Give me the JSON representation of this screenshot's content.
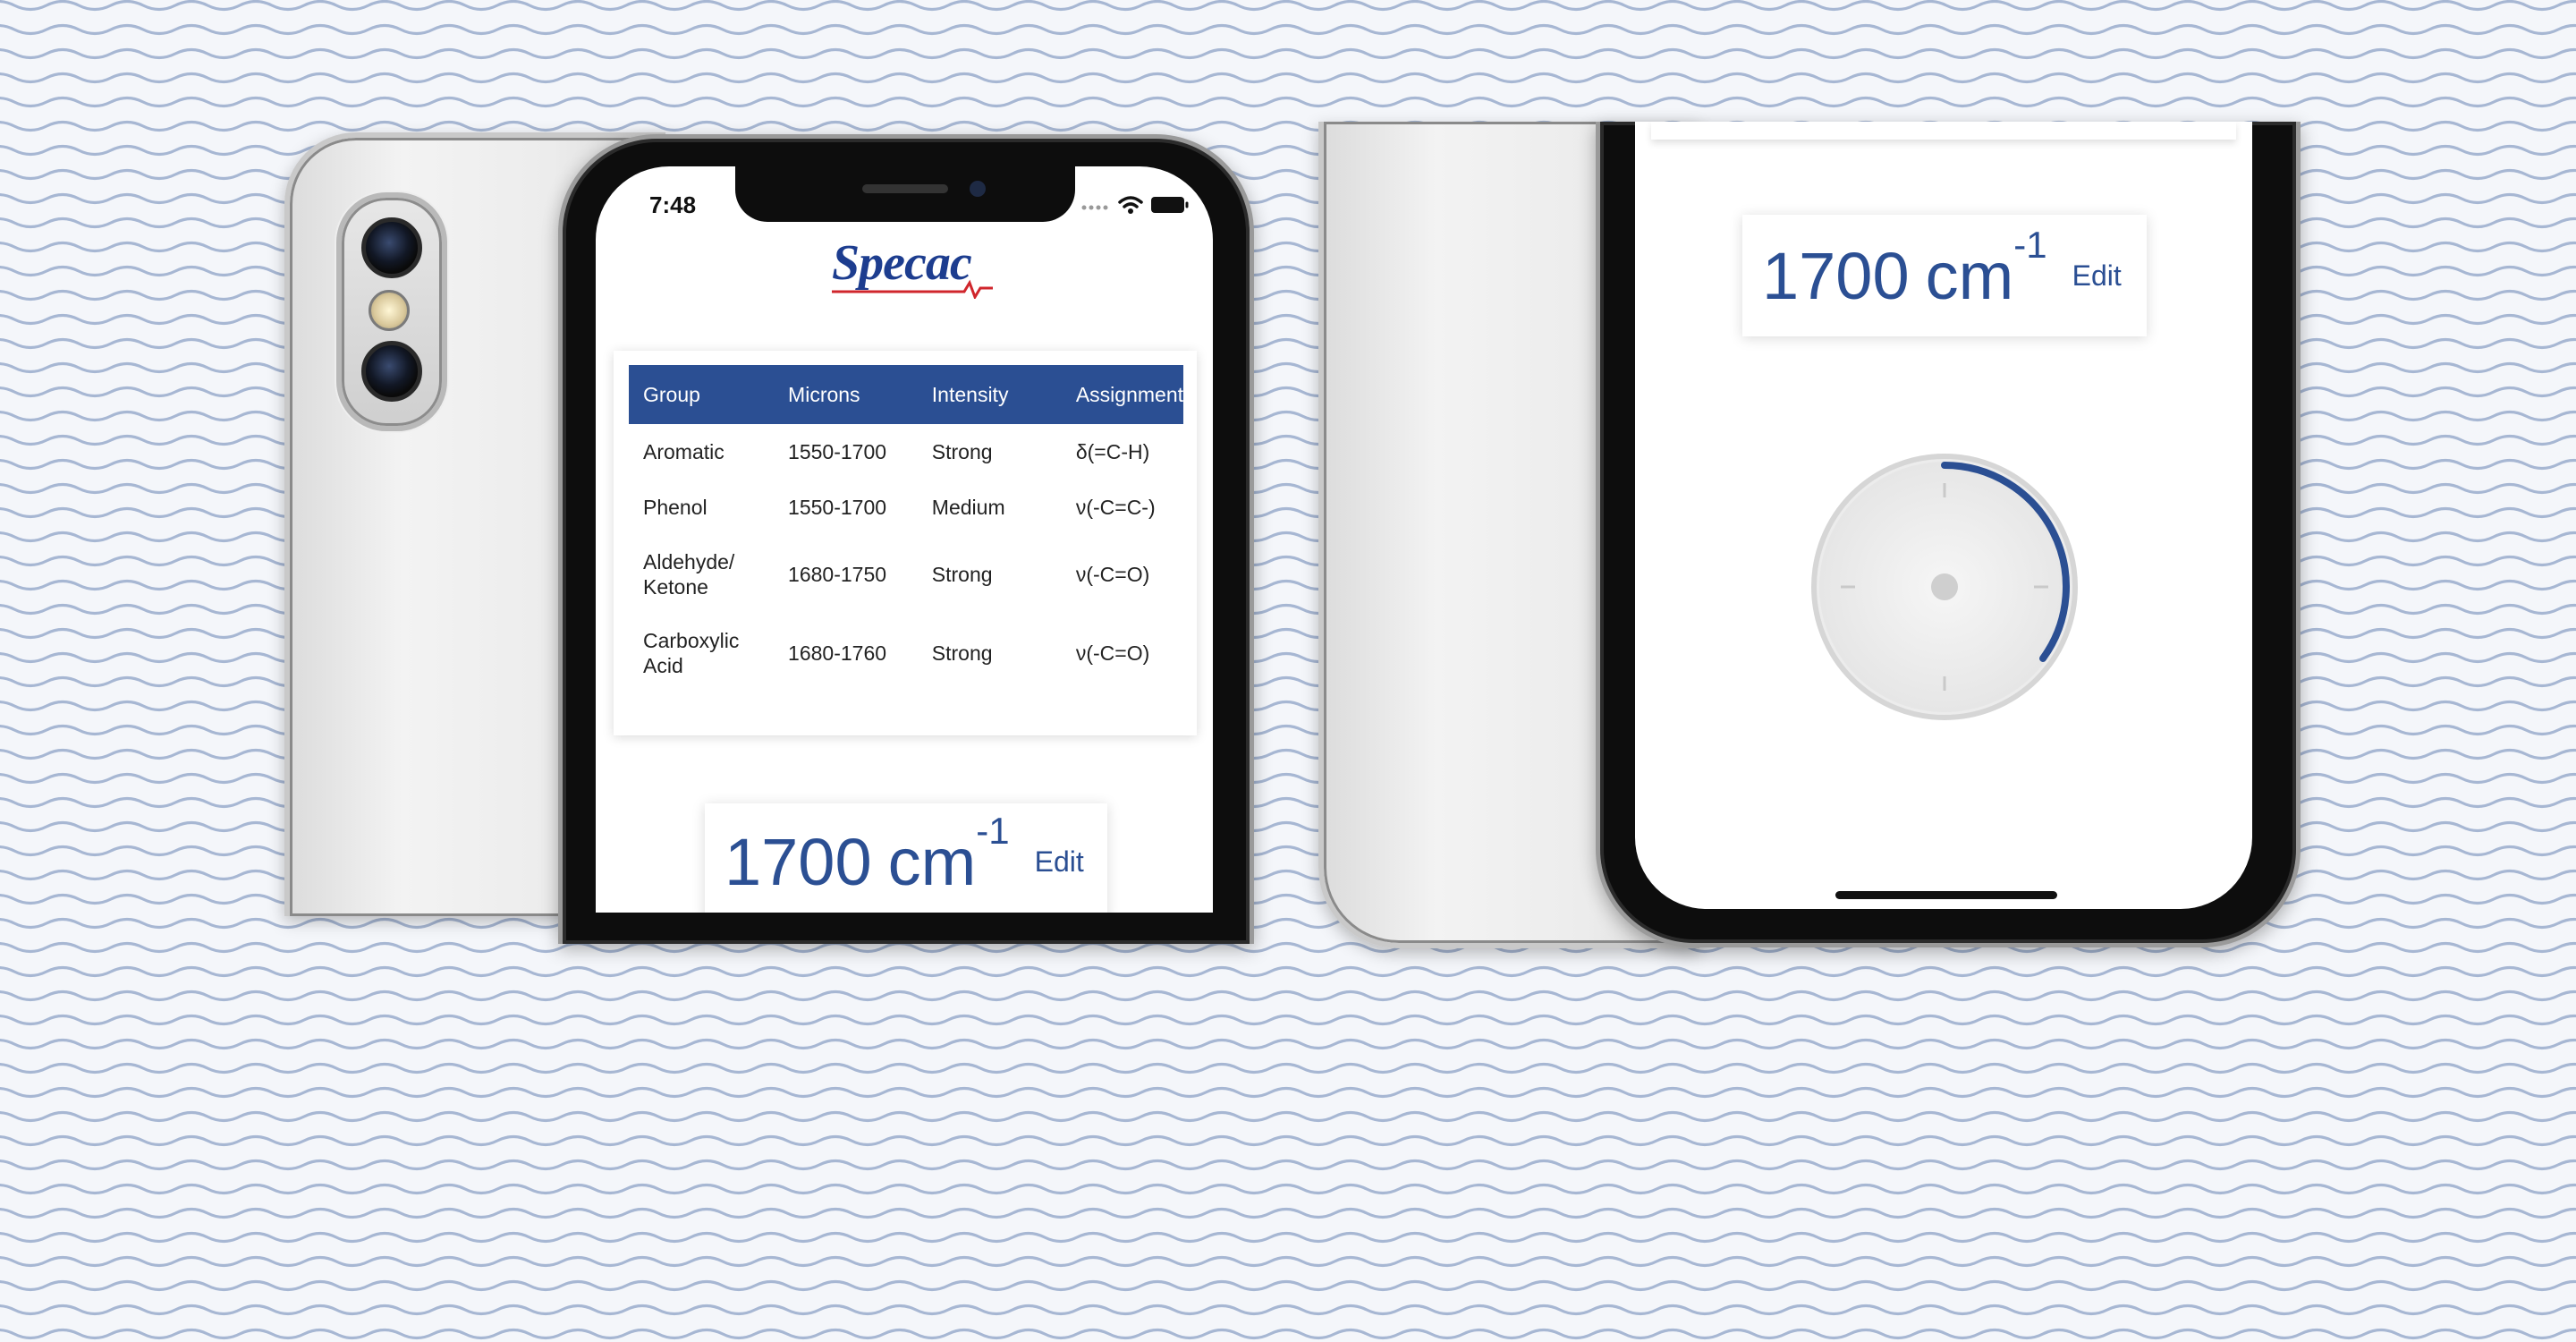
{
  "status_bar": {
    "time": "7:48"
  },
  "app": {
    "logo_text": "Specac"
  },
  "table": {
    "headers": [
      "Group",
      "Microns",
      "Intensity",
      "Assignment"
    ],
    "rows": [
      [
        "Aromatic",
        "1550-1700",
        "Strong",
        "δ(=C-H)"
      ],
      [
        "Phenol",
        "1550-1700",
        "Medium",
        "ν(-C=C-)"
      ],
      [
        "Aldehyde/\nKetone",
        "1680-1750",
        "Strong",
        "ν(-C=O)"
      ],
      [
        "Carboxylic\nAcid",
        "1680-1760",
        "Strong",
        "ν(-C=O)"
      ]
    ]
  },
  "frequency": {
    "value": "1700",
    "unit": "cm",
    "exponent": "-1",
    "edit_label": "Edit"
  },
  "dial": {
    "arc_fraction": 0.35
  },
  "colors": {
    "accent": "#2b4f93",
    "background_wave": "#a7b7d3"
  }
}
